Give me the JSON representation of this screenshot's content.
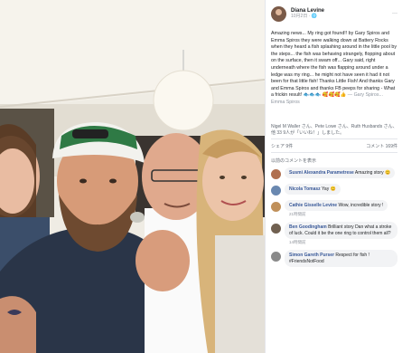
{
  "post": {
    "author": "Diana Levine",
    "meta": "10月2日 · 🌐",
    "text": "Amazing news... My ring got found!! by Gary Spiros and Emma Spiros they were walking down at Battery Rocks when they heard a fish splashing around in the little pool by the steps... the fish was behaving strangely, flopping about on the surface, then it swam off... Gary said, right underneath where the fish was flapping around under a ledge was my ring... he might not have seen it had it not been for that little fish! Thanks Little Fish! And thanks Gary and Emma Spiros and thanks FB peeps for sharing - What a frickin result!",
    "text_emoji": "🐟🐟🐟",
    "text_emoji2": "🥰🥰🥰👍",
    "tags": "— Gary Spiros... Emma Spiros"
  },
  "reactions": {
    "summary": "Nigel M Waller さん、Pete Lowe さん、Ruth Husbands さん、他 33 9人が「いいね！」しました。",
    "count": ""
  },
  "actions": {
    "share": "シェア 9件",
    "comments": "コメント 169件"
  },
  "previous_label": "以前のコメントを表示",
  "comments": [
    {
      "name": "Susmi Alexandra Parametrese",
      "text": "Amazing story 😊",
      "time": "",
      "color": "#b07050"
    },
    {
      "name": "Nicola Tomasz",
      "text": "Yay 😊",
      "time": "",
      "color": "#6a88b0"
    },
    {
      "name": "Cathie Gisselle Levine",
      "text": "Wow, incredible story !",
      "time": "21時間前",
      "color": "#c0905a"
    },
    {
      "name": "Ben Goodingham",
      "text": "Brilliant story Dan what a stroke of luck. Could it be the one ring to control them all?",
      "time": "14時間前",
      "color": "#706050"
    },
    {
      "name": "Simon Gareth Purser",
      "text": "Respect for fish ! #FriendsNotFood",
      "time": "",
      "color": "#8a8a8a"
    }
  ]
}
